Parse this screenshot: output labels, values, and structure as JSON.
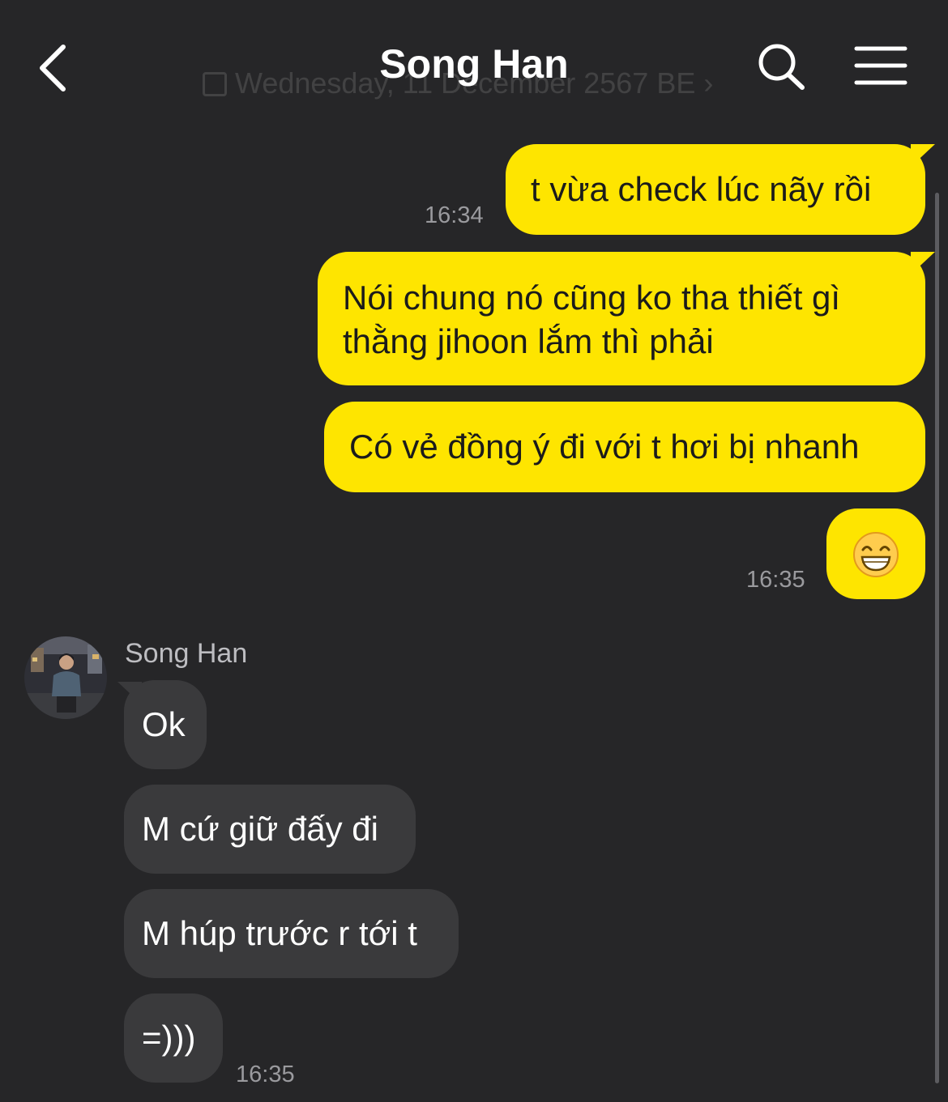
{
  "header": {
    "title": "Song Han",
    "date_label": "Wednesday, 11 December 2567 BE",
    "back_icon": "chevron-left-icon",
    "search_icon": "search-icon",
    "menu_icon": "hamburger-menu-icon"
  },
  "colors": {
    "background": "#262628",
    "outgoing_bubble": "#fee500",
    "incoming_bubble": "#3a3a3c",
    "timestamp": "#9a9a9e"
  },
  "messages_out": [
    {
      "text": "t vừa check lúc nãy rồi",
      "time": "16:34"
    },
    {
      "text": "Nói chung nó cũng ko tha thiết gì thằng jihoon lắm thì phải"
    },
    {
      "text": "Có vẻ đồng ý đi với t hơi bị nhanh"
    },
    {
      "text": "😁",
      "time": "16:35"
    }
  ],
  "sender": {
    "name": "Song Han"
  },
  "messages_in": [
    {
      "text": "Ok"
    },
    {
      "text": "M cứ giữ đấy đi"
    },
    {
      "text": "M húp trước r tới t"
    },
    {
      "text": "=)))",
      "time": "16:35"
    }
  ]
}
